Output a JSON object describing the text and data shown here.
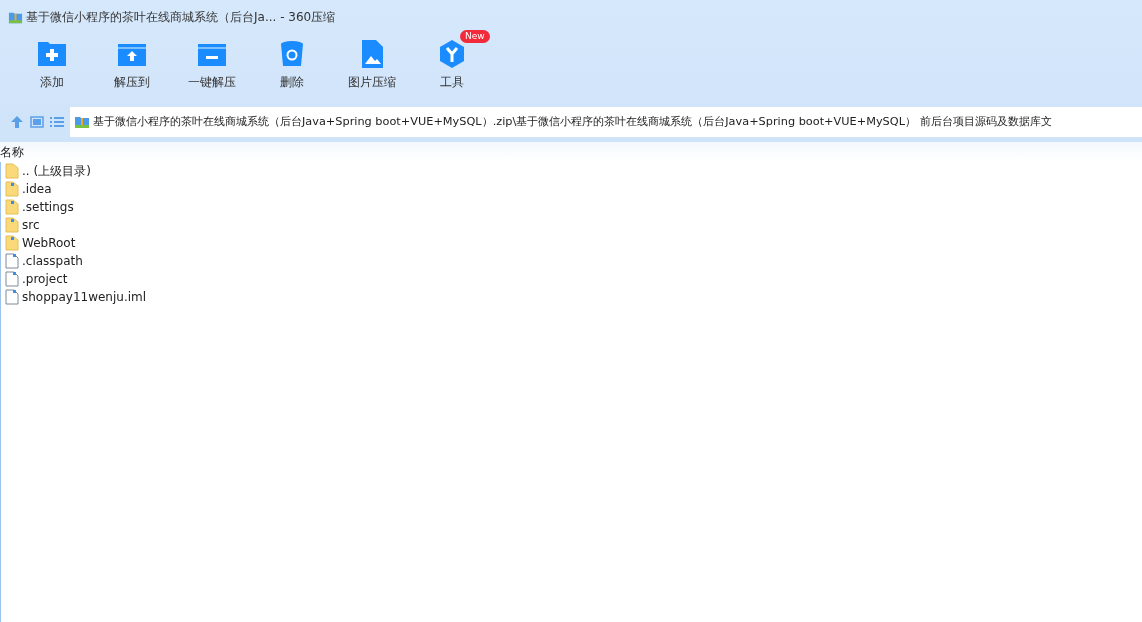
{
  "window": {
    "title": "基于微信小程序的茶叶在线商城系统（后台Ja... - 360压缩"
  },
  "toolbar": [
    {
      "kind": "add",
      "label": "添加"
    },
    {
      "kind": "extract-to",
      "label": "解压到"
    },
    {
      "kind": "extract",
      "label": "一键解压"
    },
    {
      "kind": "delete",
      "label": "删除"
    },
    {
      "kind": "image",
      "label": "图片压缩"
    },
    {
      "kind": "tools",
      "label": "工具",
      "badge": "New"
    }
  ],
  "address_bar": {
    "path": "基于微信小程序的茶叶在线商城系统（后台Java+Spring boot+VUE+MySQL）.zip\\基于微信小程序的茶叶在线商城系统（后台Java+Spring boot+VUE+MySQL） 前后台项目源码及数据库文"
  },
  "file_list": {
    "columns": [
      "名称"
    ],
    "rows": [
      {
        "kind": "parent",
        "name": ".. (上级目录)"
      },
      {
        "kind": "folder",
        "name": ".idea"
      },
      {
        "kind": "folder",
        "name": ".settings"
      },
      {
        "kind": "folder",
        "name": "src"
      },
      {
        "kind": "folder",
        "name": "WebRoot"
      },
      {
        "kind": "file",
        "name": ".classpath"
      },
      {
        "kind": "file",
        "name": ".project"
      },
      {
        "kind": "file",
        "name": "shoppay11wenju.iml"
      }
    ]
  }
}
